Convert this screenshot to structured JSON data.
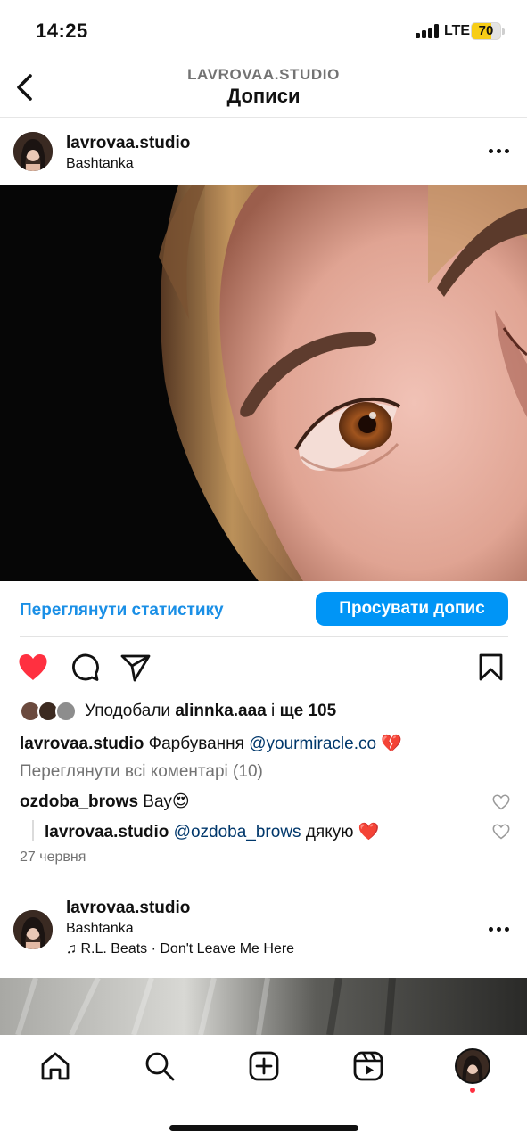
{
  "status_bar": {
    "time": "14:25",
    "network": "LTE",
    "battery": "70"
  },
  "header": {
    "account": "LAVROVAA.STUDIO",
    "title": "Дописи"
  },
  "post": {
    "username": "lavrovaa.studio",
    "location": "Bashtanka",
    "insights_label": "Переглянути статистику",
    "boost_label": "Просувати допис",
    "likes": {
      "prefix": "Уподобали",
      "user": "alinnka.aaa",
      "joiner": "і",
      "more": "ще 105"
    },
    "caption": {
      "username": "lavrovaa.studio",
      "text": "Фарбування",
      "mention": "@yourmiracle.co",
      "emoji": "💔"
    },
    "view_comments": "Переглянути всі коментарі (10)",
    "comments": [
      {
        "username": "ozdoba_brows",
        "text": "Вау😍"
      },
      {
        "username": "lavrovaa.studio",
        "mention": "@ozdoba_brows",
        "text": "дякую ❤️"
      }
    ],
    "date": "27 червня"
  },
  "next_post": {
    "username": "lavrovaa.studio",
    "location": "Bashtanka",
    "music_icon": "♫",
    "music": "R.L. Beats · Don't Leave Me Here"
  },
  "icons": {
    "back": "chevron-left-icon",
    "like": "heart-filled-icon",
    "comment": "comment-bubble-icon",
    "share": "paper-plane-icon",
    "save": "bookmark-icon",
    "tabs": [
      "home-icon",
      "search-icon",
      "create-icon",
      "reels-icon",
      "profile-avatar"
    ]
  },
  "colors": {
    "accent": "#0095f6",
    "link": "#1a8fe6",
    "mention": "#00376b",
    "like": "#ff3040",
    "battery": "#f7cd16"
  }
}
